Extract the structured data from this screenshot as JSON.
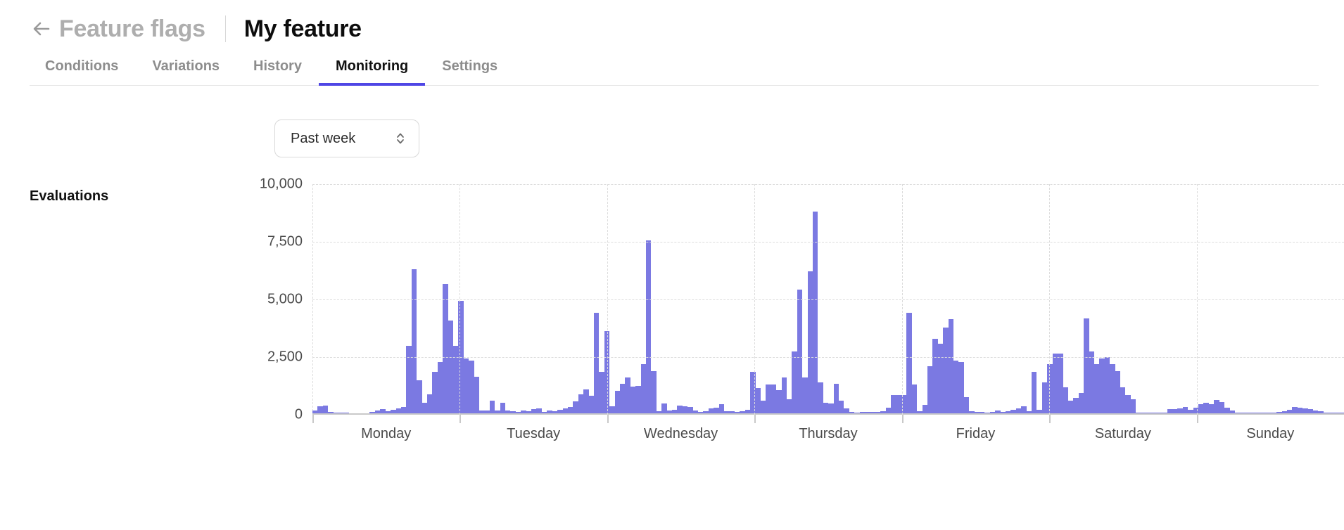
{
  "header": {
    "back_icon": "arrow-left-icon",
    "breadcrumb_parent": "Feature flags",
    "title": "My feature"
  },
  "tabs": [
    {
      "label": "Conditions",
      "active": false
    },
    {
      "label": "Variations",
      "active": false
    },
    {
      "label": "History",
      "active": false
    },
    {
      "label": "Monitoring",
      "active": true
    },
    {
      "label": "Settings",
      "active": false
    }
  ],
  "accent_color": "#4f46e5",
  "range_select": {
    "value": "Past week",
    "icon": "chevron-up-down-icon"
  },
  "chart_label": "Evaluations",
  "chart_data": {
    "type": "bar",
    "title": "Evaluations",
    "xlabel": "",
    "ylabel": "",
    "ylim": [
      0,
      10000
    ],
    "grid": true,
    "legend": false,
    "bar_color": "#7b79e2",
    "y_ticks": [
      0,
      2500,
      5000,
      7500,
      10000
    ],
    "y_tick_labels": [
      "0",
      "2,500",
      "5,000",
      "7,500",
      "10,000"
    ],
    "categories": [
      "Monday",
      "Tuesday",
      "Wednesday",
      "Thursday",
      "Friday",
      "Saturday",
      "Sunday"
    ],
    "category_tick_positions": [
      0.5,
      1.5,
      2.5,
      3.5,
      4.5,
      5.5,
      6.5
    ],
    "bin_description": "168 hourly bins spanning Monday 00:00 through Sunday 23:00",
    "values": [
      120,
      300,
      340,
      60,
      30,
      20,
      20,
      15,
      15,
      10,
      15,
      60,
      120,
      180,
      100,
      140,
      230,
      280,
      2950,
      6300,
      1450,
      450,
      830,
      1800,
      2250,
      5650,
      4050,
      2950,
      4900,
      2400,
      2300,
      1600,
      120,
      120,
      560,
      130,
      460,
      110,
      90,
      50,
      120,
      100,
      180,
      200,
      60,
      110,
      80,
      150,
      200,
      280,
      520,
      830,
      1050,
      760,
      4380,
      1800,
      3600,
      300,
      980,
      1300,
      1550,
      1180,
      1200,
      2150,
      7550,
      1850,
      100,
      420,
      120,
      150,
      330,
      310,
      280,
      130,
      60,
      90,
      200,
      260,
      400,
      90,
      80,
      60,
      100,
      160,
      1800,
      1100,
      560,
      1270,
      1270,
      1000,
      1570,
      620,
      2700,
      5400,
      1580,
      6200,
      8800,
      1350,
      460,
      420,
      1280,
      560,
      200,
      70,
      40,
      60,
      50,
      70,
      60,
      100,
      250,
      800,
      800,
      800,
      4380,
      1250,
      100,
      360,
      2050,
      3250,
      3050,
      3750,
      4100,
      2300,
      2250,
      700,
      80,
      60,
      50,
      40,
      70,
      110,
      60,
      80,
      140,
      220,
      310,
      90,
      1800,
      150,
      1350,
      2150,
      2600,
      2600,
      1150,
      550,
      680,
      900,
      4150,
      2700,
      2150,
      2380,
      2450,
      2150,
      1850,
      1150,
      800,
      620,
      30,
      30,
      30,
      20,
      20,
      20,
      180,
      180,
      210,
      270,
      150,
      260,
      400,
      460,
      390,
      570,
      490,
      240,
      130,
      40,
      30,
      20,
      20,
      25,
      20,
      30,
      40,
      50,
      90,
      160,
      290,
      250,
      230,
      170,
      120,
      100,
      40,
      30,
      30,
      25
    ]
  }
}
